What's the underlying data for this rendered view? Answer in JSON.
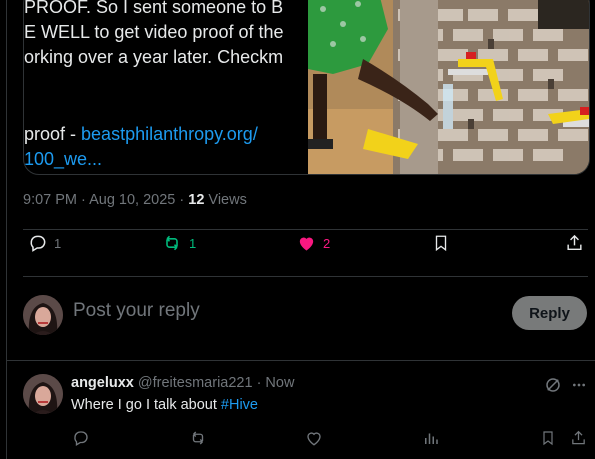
{
  "card": {
    "lines": [
      "PROOF. So I sent someone to B",
      "E WELL to get video proof of the",
      "orking over a year later. Checkm"
    ],
    "proof_prefix": "proof - ",
    "link_line1": "beastphilanthropy.org/",
    "link_line2": "100_we..."
  },
  "meta": {
    "time": "9:07 PM · Aug 10, 2025 · ",
    "views_count": "12",
    "views_label": " Views"
  },
  "actions": {
    "replies": "1",
    "reposts": "1",
    "likes": "2"
  },
  "compose": {
    "placeholder": "Post your reply",
    "button": "Reply"
  },
  "reply": {
    "name": "angeluxx",
    "handle": "@freitesmaria221 · Now",
    "text_prefix": "Where I go I talk about ",
    "hashtag": "#Hive"
  },
  "colors": {
    "accent": "#1d9bf0",
    "repost_active": "#00ba7c",
    "like_active": "#f91880",
    "muted": "#71767b"
  }
}
